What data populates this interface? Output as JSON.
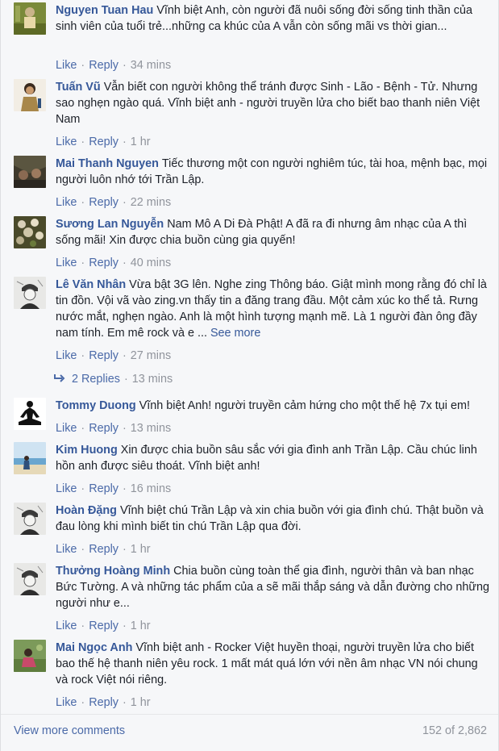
{
  "comments": [
    {
      "author": "Nguyen Tuan Hau",
      "text": "Vĩnh biệt Anh, còn người đã nuôi sống đời sống tinh thần của sinh viên của tuổi trẻ...những ca khúc của A vẫn còn sống mãi vs thời gian...",
      "like": "Like",
      "reply": "Reply",
      "time": "34 mins",
      "avatar": "photo-avatar"
    },
    {
      "author": "Tuấn Vũ",
      "text": "Vẫn biết con người không thể tránh được Sinh - Lão - Bệnh - Tử. Nhưng sao nghẹn ngào quá. Vĩnh biệt anh - người truyền lửa cho biết bao thanh niên Việt Nam",
      "like": "Like",
      "reply": "Reply",
      "time": "1 hr",
      "avatar": "photo-avatar"
    },
    {
      "author": "Mai Thanh Nguyen",
      "text": "Tiếc thương một con người nghiêm túc, tài hoa, mệnh bạc, mọi người luôn nhớ tới Trần Lập.",
      "like": "Like",
      "reply": "Reply",
      "time": "22 mins",
      "avatar": "photo-avatar"
    },
    {
      "author": "Sương Lan Nguyễn",
      "text": "Nam Mô A Di Đà Phật! A đã ra đi nhưng âm nhạc của A thì sống mãi! Xin được chia buồn cùng gia quyến!",
      "like": "Like",
      "reply": "Reply",
      "time": "40 mins",
      "avatar": "photo-avatar"
    },
    {
      "author": "Lê Văn Nhân",
      "text": "Vừa bật 3G lên. Nghe zing Thông báo. Giật mình mong rằng đó chỉ là tin đồn. Vội vã vào zing.vn thấy tin a đăng trang đầu. Một cảm xúc ko thể tả. Rưng nước mắt, nghẹn ngào. Anh là một hình tượng mạnh mẽ. Là 1 người đàn ông đầy nam tính. Em mê rock và e ...",
      "see_more": "See more",
      "like": "Like",
      "reply": "Reply",
      "time": "27 mins",
      "avatar": "sketch-avatar"
    },
    {
      "author": "Tommy Duong",
      "text": "Vĩnh biệt Anh! người truyền cảm hứng cho một thế hệ 7x tụi em!",
      "like": "Like",
      "reply": "Reply",
      "time": "13 mins",
      "avatar": "meditation-avatar"
    },
    {
      "author": "Kim Huong",
      "text": "Xin được chia buồn sâu sắc với gia đình anh Trần Lập. Cầu chúc linh hồn anh được siêu thoát. Vĩnh biệt anh!",
      "like": "Like",
      "reply": "Reply",
      "time": "16 mins",
      "avatar": "beach-avatar"
    },
    {
      "author": "Hoàn Đặng",
      "text": "Vĩnh biệt chú Trần Lập và xin chia buồn với gia đình chú. Thật buồn và đau lòng khi mình biết tin chú Trần Lập qua đời.",
      "like": "Like",
      "reply": "Reply",
      "time": "1 hr",
      "avatar": "sketch-avatar"
    },
    {
      "author": "Thưởng Hoàng Minh",
      "text": "Chia buồn cùng toàn thể gia đình, người thân và ban nhạc Bức Tường. A và những tác phẩm của a sẽ mãi thắp sáng và dẫn đường cho những người như e...",
      "like": "Like",
      "reply": "Reply",
      "time": "1 hr",
      "avatar": "sketch-avatar"
    },
    {
      "author": "Mai Ngọc Anh",
      "text": "Vĩnh biệt anh - Rocker Việt huyền thoại, người truyền lửa cho biết bao thế hệ thanh niên yêu rock. 1 mất mát quá lớn với nền âm nhạc VN nói chung và rock Việt nói riêng.",
      "like": "Like",
      "reply": "Reply",
      "time": "1 hr",
      "avatar": "photo-avatar"
    }
  ],
  "replies_link": {
    "icon": "reply-arrow-icon",
    "label": "2 Replies",
    "time": "13 mins"
  },
  "footer": {
    "view_more": "View more comments",
    "count": "152 of 2,862"
  },
  "colors": {
    "author": "#365899",
    "link": "#4b6aa8",
    "meta": "#90949c",
    "text": "#1d2129"
  }
}
